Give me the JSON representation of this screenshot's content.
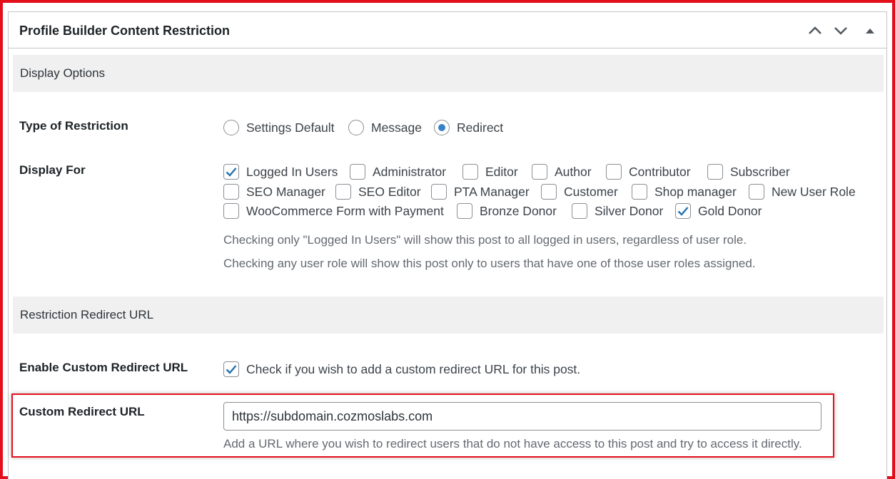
{
  "panel": {
    "title": "Profile Builder Content Restriction"
  },
  "sections": {
    "display_options": "Display Options",
    "redirect_url": "Restriction Redirect URL"
  },
  "type_of_restriction": {
    "label": "Type of Restriction",
    "options": [
      {
        "label": "Settings Default",
        "selected": false
      },
      {
        "label": "Message",
        "selected": false
      },
      {
        "label": "Redirect",
        "selected": true
      }
    ]
  },
  "display_for": {
    "label": "Display For",
    "options": [
      {
        "label": "Logged In Users",
        "checked": true
      },
      {
        "label": "Administrator",
        "checked": false
      },
      {
        "label": "Editor",
        "checked": false
      },
      {
        "label": "Author",
        "checked": false
      },
      {
        "label": "Contributor",
        "checked": false
      },
      {
        "label": "Subscriber",
        "checked": false
      },
      {
        "label": "SEO Manager",
        "checked": false
      },
      {
        "label": "SEO Editor",
        "checked": false
      },
      {
        "label": "PTA Manager",
        "checked": false
      },
      {
        "label": "Customer",
        "checked": false
      },
      {
        "label": "Shop manager",
        "checked": false
      },
      {
        "label": "New User Role",
        "checked": false
      },
      {
        "label": "WooCommerce Form with Payment",
        "checked": false
      },
      {
        "label": "Bronze Donor",
        "checked": false
      },
      {
        "label": "Silver Donor",
        "checked": false
      },
      {
        "label": "Gold Donor",
        "checked": true
      }
    ],
    "help_1": "Checking only \"Logged In Users\" will show this post to all logged in users, regardless of user role.",
    "help_2": "Checking any user role will show this post only to users that have one of those user roles assigned."
  },
  "enable_custom_redirect": {
    "label": "Enable Custom Redirect URL",
    "checked": true,
    "option_label": "Check if you wish to add a custom redirect URL for this post."
  },
  "custom_redirect_url": {
    "label": "Custom Redirect URL",
    "value": "https://subdomain.cozmoslabs.com",
    "help": "Add a URL where you wish to redirect users that do not have access to this post and try to access it directly."
  },
  "colors": {
    "highlight": "#e3101c",
    "accent": "#3582c4",
    "section_bg": "#f0f0f1",
    "border": "#c3c4c7"
  }
}
